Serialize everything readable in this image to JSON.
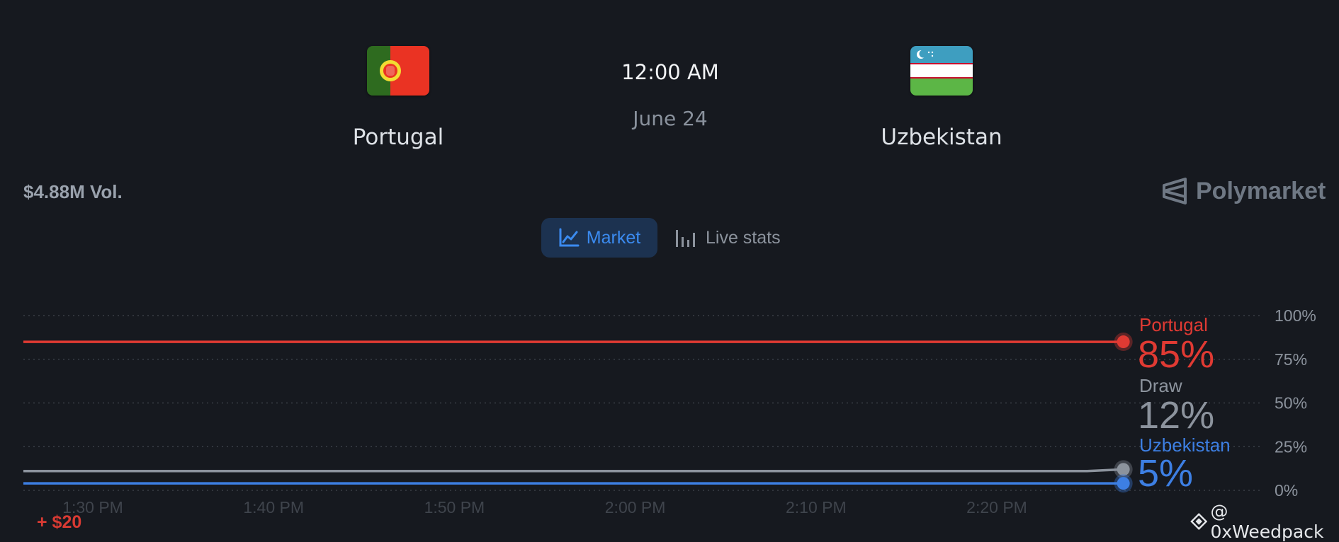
{
  "match": {
    "home": {
      "name": "Portugal"
    },
    "away": {
      "name": "Uzbekistan"
    },
    "time": "12:00 AM",
    "date": "June 24"
  },
  "volume": "$4.88M Vol.",
  "brand": {
    "name": "Polymarket",
    "icon": "polymarket-logo-icon"
  },
  "tabs": [
    {
      "label": "Market",
      "icon": "line-chart-icon",
      "active": true
    },
    {
      "label": "Live stats",
      "icon": "bar-chart-icon",
      "active": false
    }
  ],
  "outcomes": [
    {
      "name": "Portugal",
      "pct": "85%",
      "color": "#e03a33"
    },
    {
      "name": "Draw",
      "pct": "12%",
      "color": "#8c939d"
    },
    {
      "name": "Uzbekistan",
      "pct": "5%",
      "color": "#3d7fe3"
    }
  ],
  "trade_tag": "+ $20",
  "watermark": "@ 0xWeedpack",
  "chart_data": {
    "type": "line",
    "x_ticks": [
      "1:30 PM",
      "1:40 PM",
      "1:50 PM",
      "2:00 PM",
      "2:10 PM",
      "2:20 PM"
    ],
    "y_ticks": [
      "100%",
      "75%",
      "50%",
      "25%",
      "0%"
    ],
    "ylim": [
      0,
      100
    ],
    "xlim": [
      "1:28 PM",
      "2:35 PM"
    ],
    "grid": true,
    "series": [
      {
        "name": "Portugal",
        "color": "#e03a33",
        "x": [
          "1:28 PM",
          "2:27 PM"
        ],
        "values": [
          85,
          85
        ]
      },
      {
        "name": "Draw",
        "color": "#8c939d",
        "x": [
          "1:28 PM",
          "2:25 PM",
          "2:27 PM"
        ],
        "values": [
          11,
          11,
          12
        ]
      },
      {
        "name": "Uzbekistan",
        "color": "#3d7fe3",
        "x": [
          "1:28 PM",
          "2:27 PM"
        ],
        "values": [
          4,
          4
        ]
      }
    ]
  }
}
